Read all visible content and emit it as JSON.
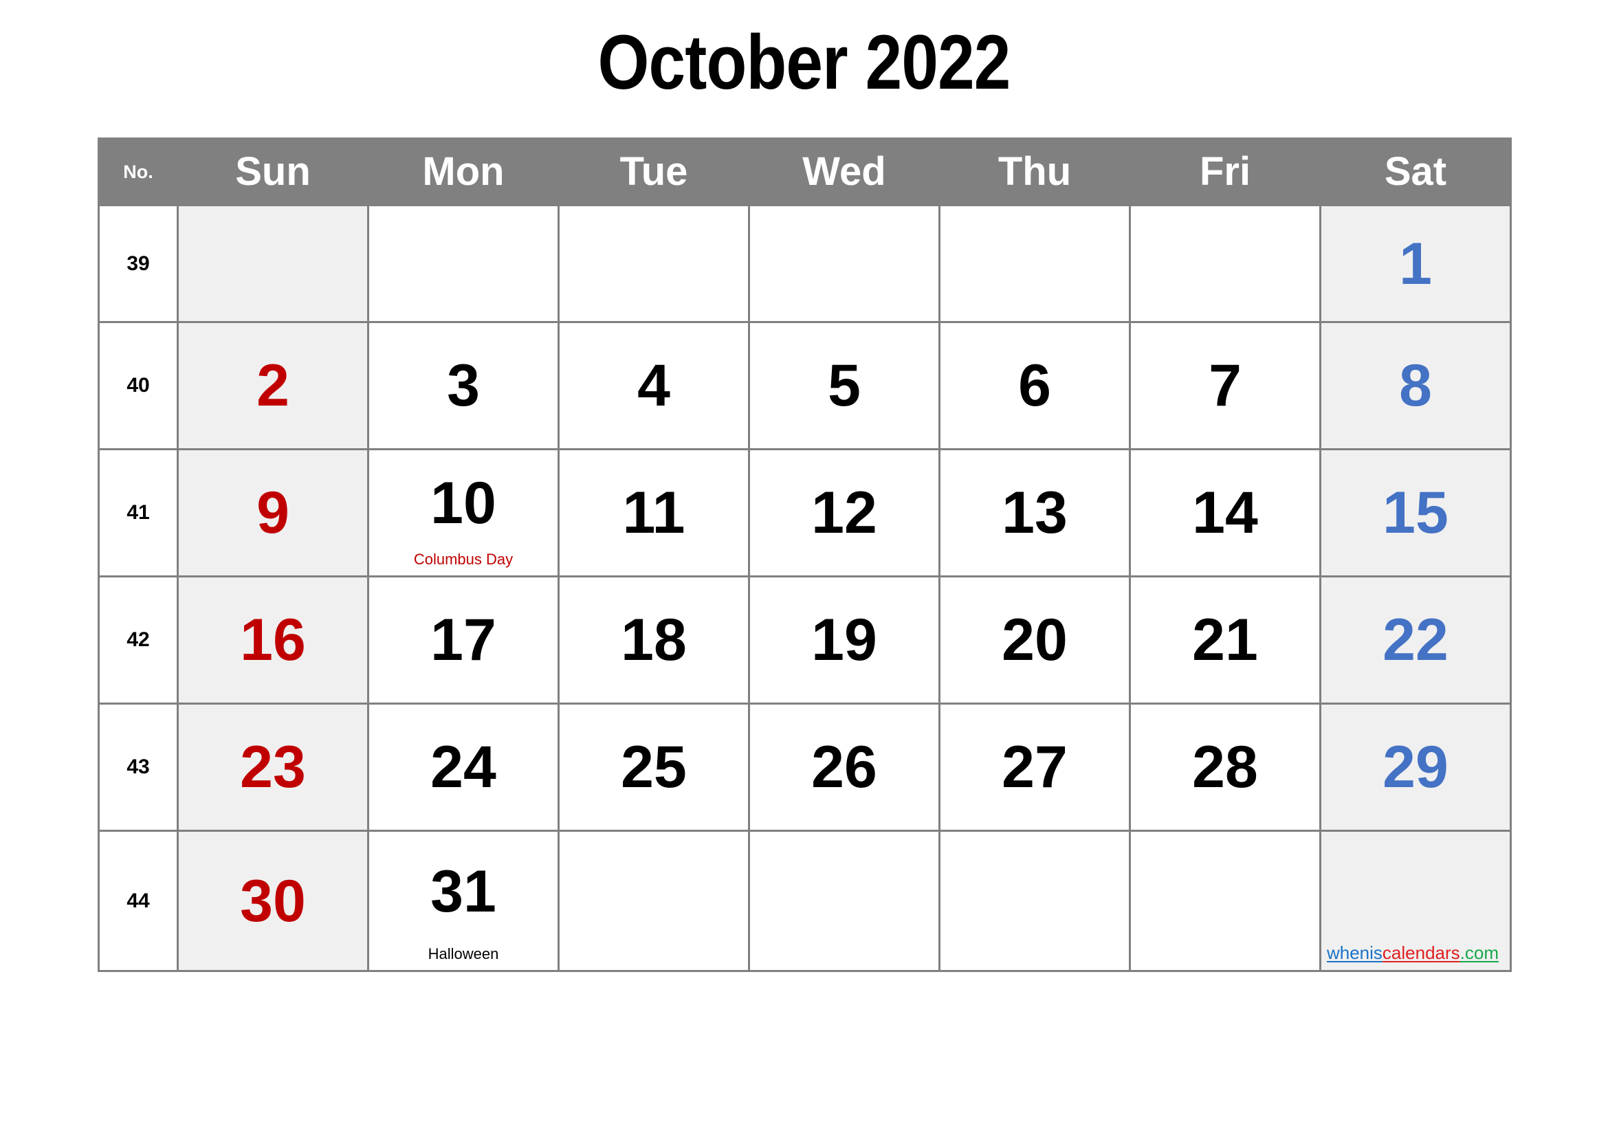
{
  "title": "October 2022",
  "colors": {
    "header_bg": "#808080",
    "header_text": "#ffffff",
    "grid_line": "#808080",
    "weekend_bg": "#F0F0F0",
    "weekday_bg": "#ffffff",
    "sunday_number": "#C00000",
    "saturday_number": "#4472C4",
    "weekday_number": "#000000",
    "holiday_red": "#C00000",
    "brand_blue": "#1A73C8",
    "brand_red": "#E02020",
    "brand_green": "#17A84A"
  },
  "header": {
    "week_no_label": "No.",
    "days": [
      "Sun",
      "Mon",
      "Tue",
      "Wed",
      "Thu",
      "Fri",
      "Sat"
    ]
  },
  "weeks": [
    {
      "number": "39",
      "days": [
        {
          "num": "",
          "holiday": ""
        },
        {
          "num": "",
          "holiday": ""
        },
        {
          "num": "",
          "holiday": ""
        },
        {
          "num": "",
          "holiday": ""
        },
        {
          "num": "",
          "holiday": ""
        },
        {
          "num": "",
          "holiday": ""
        },
        {
          "num": "1",
          "holiday": ""
        }
      ]
    },
    {
      "number": "40",
      "days": [
        {
          "num": "2",
          "holiday": ""
        },
        {
          "num": "3",
          "holiday": ""
        },
        {
          "num": "4",
          "holiday": ""
        },
        {
          "num": "5",
          "holiday": ""
        },
        {
          "num": "6",
          "holiday": ""
        },
        {
          "num": "7",
          "holiday": ""
        },
        {
          "num": "8",
          "holiday": ""
        }
      ]
    },
    {
      "number": "41",
      "days": [
        {
          "num": "9",
          "holiday": ""
        },
        {
          "num": "10",
          "holiday": "Columbus Day"
        },
        {
          "num": "11",
          "holiday": ""
        },
        {
          "num": "12",
          "holiday": ""
        },
        {
          "num": "13",
          "holiday": ""
        },
        {
          "num": "14",
          "holiday": ""
        },
        {
          "num": "15",
          "holiday": ""
        }
      ]
    },
    {
      "number": "42",
      "days": [
        {
          "num": "16",
          "holiday": ""
        },
        {
          "num": "17",
          "holiday": ""
        },
        {
          "num": "18",
          "holiday": ""
        },
        {
          "num": "19",
          "holiday": ""
        },
        {
          "num": "20",
          "holiday": ""
        },
        {
          "num": "21",
          "holiday": ""
        },
        {
          "num": "22",
          "holiday": ""
        }
      ]
    },
    {
      "number": "43",
      "days": [
        {
          "num": "23",
          "holiday": ""
        },
        {
          "num": "24",
          "holiday": ""
        },
        {
          "num": "25",
          "holiday": ""
        },
        {
          "num": "26",
          "holiday": ""
        },
        {
          "num": "27",
          "holiday": ""
        },
        {
          "num": "28",
          "holiday": ""
        },
        {
          "num": "29",
          "holiday": ""
        }
      ]
    },
    {
      "number": "44",
      "days": [
        {
          "num": "30",
          "holiday": ""
        },
        {
          "num": "31",
          "holiday": "Halloween"
        },
        {
          "num": "",
          "holiday": ""
        },
        {
          "num": "",
          "holiday": ""
        },
        {
          "num": "",
          "holiday": ""
        },
        {
          "num": "",
          "holiday": ""
        },
        {
          "num": "",
          "holiday": ""
        }
      ]
    }
  ],
  "brand": {
    "part1": "whenis",
    "part2": "calendars",
    "part3": ".com"
  }
}
